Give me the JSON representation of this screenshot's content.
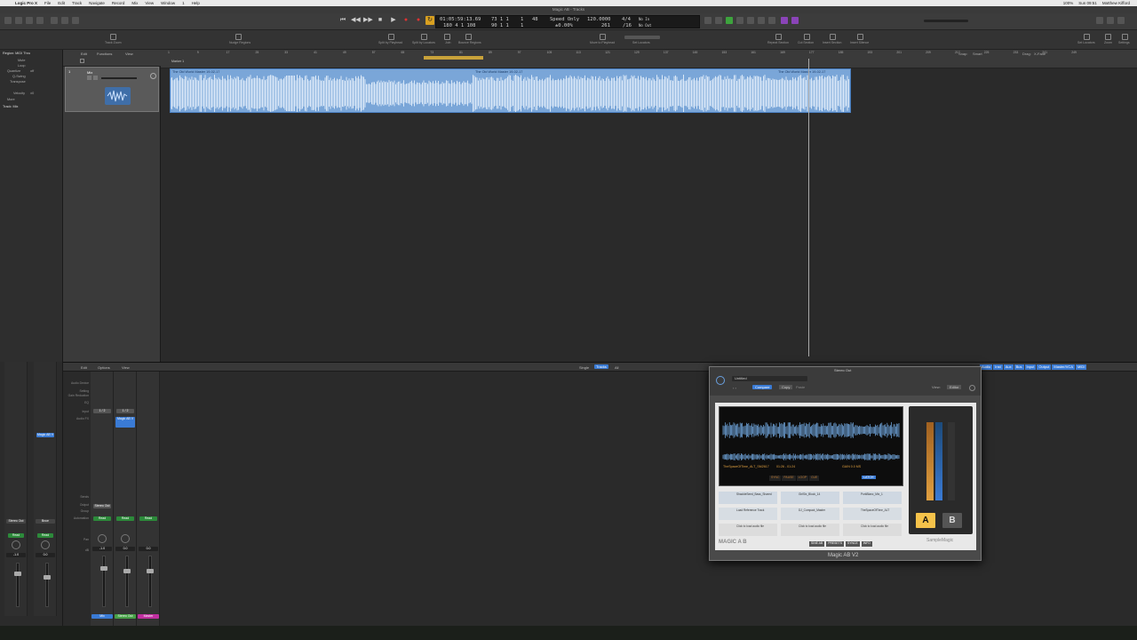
{
  "menubar": {
    "app": "Logic Pro X",
    "items": [
      "File",
      "Edit",
      "Track",
      "Navigate",
      "Record",
      "Mix",
      "View",
      "Window",
      "1",
      "Help"
    ],
    "right": [
      "100%",
      "Sun 09:51",
      "Matthew Kifford"
    ]
  },
  "window_title": "Magic AB - Tracks",
  "lcd": {
    "time": "01:05:59:13.69",
    "bars": "180 4 1 108",
    "position_a": "73 1 1",
    "position_b": "90 1 1",
    "a_sub": "1",
    "b_sub": "1",
    "division": "48",
    "mode": "Speed Only",
    "tempo": "120.0000",
    "tempo_sub": "±0.00%",
    "tempo_extra": "261",
    "signature": "4/4",
    "division_extra": "/16",
    "no_in": "No In",
    "no_out": "No Out"
  },
  "toolbar_labels": [
    "Track Zoom",
    "Nudge Regions",
    "Split by Playhead",
    "Split by Locators",
    "Join",
    "Bounce Regions",
    "Move to Playhead",
    "Set Locators",
    "Repeat Section",
    "Cut Section",
    "Insert Section",
    "Insert Silence",
    "Set Locators",
    "Zoom",
    "Settings"
  ],
  "inspector": {
    "region_label": "Region: MIDI Thru",
    "rows": [
      "Mute",
      "Loop",
      "Quantize",
      "Q-Swing",
      "Transpose",
      "Velocity",
      "More",
      "Track: Mix"
    ],
    "values": [
      "off",
      "",
      "off",
      "",
      "",
      "±0",
      "",
      ""
    ]
  },
  "track": {
    "name": "Mix",
    "number": "1"
  },
  "region": {
    "name_1": "The Old World Master 19-02-17",
    "name_2": "The Old World Master 19-02-17",
    "name_3": "The Old World Master 19-02-17"
  },
  "ruler_marker": "Marker 1",
  "ruler_numbers": [
    "1",
    "9",
    "17",
    "25",
    "33",
    "41",
    "49",
    "57",
    "65",
    "73",
    "81",
    "89",
    "97",
    "105",
    "113",
    "121",
    "129",
    "137",
    "145",
    "153",
    "161",
    "169",
    "177",
    "185",
    "193",
    "201",
    "209",
    "217",
    "225",
    "233",
    "241",
    "249"
  ],
  "mixer": {
    "menu": [
      "Edit",
      "Options",
      "View"
    ],
    "filters": [
      "Single",
      "Tracks",
      "All"
    ],
    "right_filters": [
      "Audio",
      "Inst",
      "Aux",
      "Bus",
      "Input",
      "Output",
      "Master/VCA",
      "MIDI"
    ],
    "labels": [
      "Audio Device",
      "Setting",
      "Gain Reduction",
      "EQ",
      "Input",
      "Audio FX",
      "Sends",
      "Output",
      "Group",
      "Automation",
      "Pan",
      "dB"
    ],
    "strips": [
      {
        "name": "Mix",
        "output": "Stereo Out",
        "plugin": "Magic AB V",
        "read": "Read",
        "db": "-1.0",
        "color": "#3a7bd5"
      },
      {
        "name": "Stereo Out",
        "output": "",
        "plugin": "",
        "read": "Read",
        "db": "0.0",
        "color": "#46a046"
      },
      {
        "name": "Master",
        "output": "",
        "plugin": "",
        "read": "Read",
        "db": "0.0",
        "color": "#c02fa0"
      }
    ],
    "left_strips": [
      {
        "name": "Stereo Out",
        "read": "Read",
        "db": "-1.0"
      },
      {
        "name": "Bnce",
        "read": "Read",
        "db": "0.0"
      }
    ]
  },
  "plugin": {
    "window_title": "Stereo Out",
    "preset": "Untitled",
    "compare": "Compare",
    "copy": "Copy",
    "paste": "Paste",
    "view_label": "View:",
    "view_value": "Editor",
    "footer": "Magic AB V2",
    "brand": "SampleMagic",
    "logo": "MAGIC A B",
    "track_info": "TheSpaceOfTime_ALT_SM2617",
    "time_info": "01:26 - 01:24",
    "gain_info": "GAIN 0.0 MS",
    "latch": "LATCH",
    "buttons": [
      "SYNC",
      "PAUSE",
      "LOOP",
      "CUE"
    ],
    "slots": [
      {
        "a": "ShackleSeed_Bass_Shared",
        "b": "GirlSix_Block_14",
        "c": "PorkBlanc_Mix_1"
      },
      {
        "a": "Load Reference Track",
        "b": "DJ_Compact_Master",
        "c": "TheSpaceOfTime_ALT"
      },
      {
        "a": "Click to load audio file",
        "b": "Click to load audio file",
        "c": "Click to load audio file"
      }
    ],
    "bottom_buttons": [
      "SINE AB",
      "PRESETS",
      "SYNCE",
      "INFO"
    ],
    "a_label": "A",
    "b_label": "B",
    "meter_scale": [
      "0",
      "-6",
      "-12",
      "-18",
      "-24",
      "-30"
    ]
  },
  "colors": {
    "region": "#7aa6d8",
    "region_wave": "#e6f0fb",
    "selected_blue": "#3a7bd5",
    "ab_active": "#f5c24a"
  }
}
